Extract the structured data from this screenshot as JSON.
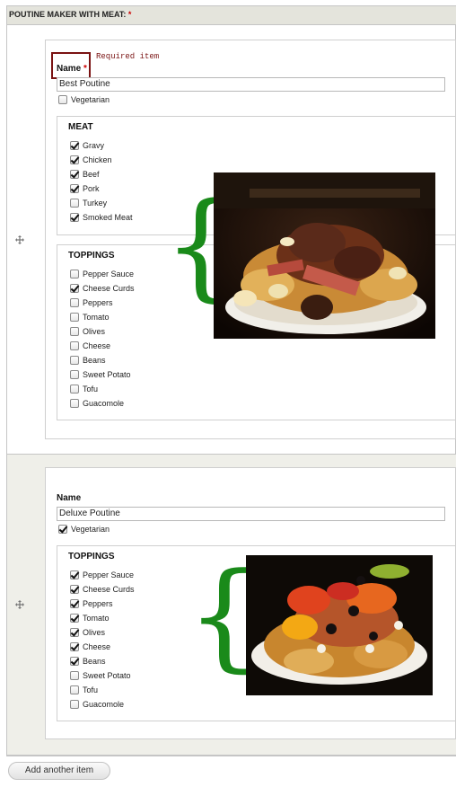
{
  "field_title": "POUTINE MAKER WITH MEAT:",
  "required_marker": "*",
  "annotation": {
    "required_note": "Required item"
  },
  "items": [
    {
      "name_label": "Name",
      "name_value": "Best Poutine",
      "vegetarian": {
        "label": "Vegetarian",
        "checked": false
      },
      "meat": {
        "title": "MEAT",
        "options": [
          {
            "label": "Gravy",
            "checked": true
          },
          {
            "label": "Chicken",
            "checked": true
          },
          {
            "label": "Beef",
            "checked": true
          },
          {
            "label": "Pork",
            "checked": true
          },
          {
            "label": "Turkey",
            "checked": false
          },
          {
            "label": "Smoked Meat",
            "checked": true
          }
        ]
      },
      "toppings": {
        "title": "TOPPINGS",
        "options": [
          {
            "label": "Pepper Sauce",
            "checked": false
          },
          {
            "label": "Cheese Curds",
            "checked": true
          },
          {
            "label": "Peppers",
            "checked": false
          },
          {
            "label": "Tomato",
            "checked": false
          },
          {
            "label": "Olives",
            "checked": false
          },
          {
            "label": "Cheese",
            "checked": false
          },
          {
            "label": "Beans",
            "checked": false
          },
          {
            "label": "Sweet Potato",
            "checked": false
          },
          {
            "label": "Tofu",
            "checked": false
          },
          {
            "label": "Guacomole",
            "checked": false
          }
        ]
      }
    },
    {
      "name_label": "Name",
      "name_value": "Deluxe Poutine",
      "vegetarian": {
        "label": "Vegetarian",
        "checked": true
      },
      "toppings": {
        "title": "TOPPINGS",
        "options": [
          {
            "label": "Pepper Sauce",
            "checked": true
          },
          {
            "label": "Cheese Curds",
            "checked": true
          },
          {
            "label": "Peppers",
            "checked": true
          },
          {
            "label": "Tomato",
            "checked": true
          },
          {
            "label": "Olives",
            "checked": true
          },
          {
            "label": "Cheese",
            "checked": true
          },
          {
            "label": "Beans",
            "checked": true
          },
          {
            "label": "Sweet Potato",
            "checked": false
          },
          {
            "label": "Tofu",
            "checked": false
          },
          {
            "label": "Guacomole",
            "checked": false
          }
        ]
      }
    }
  ],
  "brace_glyph": "{",
  "add_button_label": "Add another item",
  "icons": {
    "drag": "drag-handle-icon",
    "checkbox": "checkbox-icon"
  },
  "colors": {
    "required": "#cc0000",
    "annotation_box": "#7a1212",
    "brace": "#1a8a1a",
    "header_bg": "#e4e4dc",
    "alt_row_bg": "#efefe9"
  }
}
